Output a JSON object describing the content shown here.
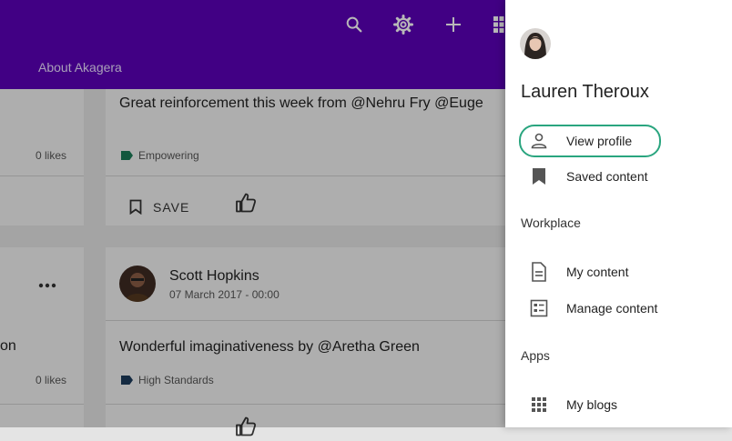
{
  "header": {
    "nav_link": "About Akagera",
    "icons": [
      "search-icon",
      "gear-icon",
      "plus-icon",
      "apps-grid-icon"
    ],
    "background": "#5a00b8"
  },
  "feed": {
    "card1": {
      "text": "Great reinforcement this week from @Nehru Fry @Euge",
      "tag": "Empowering",
      "tag_color": "#1b7a57",
      "save_label": "SAVE"
    },
    "left_card1": {
      "likes": "0 likes"
    },
    "left_card2": {
      "text_fragment": "on",
      "likes": "0 likes"
    },
    "card2": {
      "author": "Scott Hopkins",
      "date": "07 March 2017 - 00:00",
      "text": "Wonderful imaginativeness by @Aretha Green",
      "tag": "High Standards",
      "tag_color": "#1d3b5a"
    }
  },
  "drawer": {
    "user_name": "Lauren Theroux",
    "items": [
      {
        "label": "View profile",
        "icon": "person-icon"
      },
      {
        "label": "Saved content",
        "icon": "bookmark-icon"
      }
    ],
    "sections": [
      {
        "title": "Workplace",
        "items": [
          {
            "label": "My content",
            "icon": "document-icon"
          },
          {
            "label": "Manage content",
            "icon": "manage-list-icon"
          }
        ]
      },
      {
        "title": "Apps",
        "items": [
          {
            "label": "My blogs",
            "icon": "apps-grid-icon"
          }
        ]
      }
    ],
    "focus_color": "#2aa57f"
  }
}
